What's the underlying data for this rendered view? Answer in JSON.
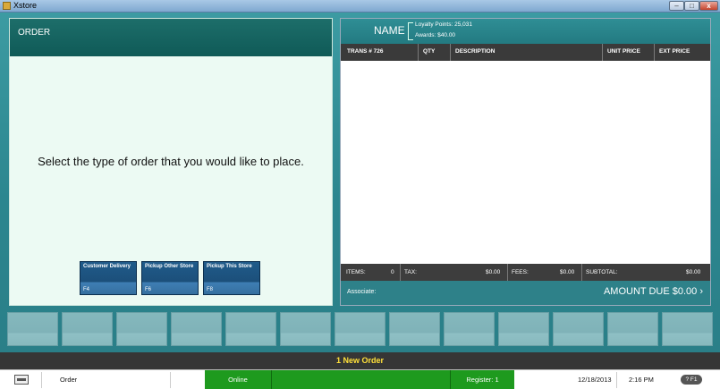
{
  "window": {
    "title": "Xstore",
    "min_symbol": "–",
    "max_symbol": "□",
    "close_symbol": "x"
  },
  "order_panel": {
    "header": "ORDER",
    "prompt": "Select the type of order that you would like to place.",
    "buttons": [
      {
        "label": "Customer Delivery",
        "key": "F4"
      },
      {
        "label": "Pickup Other Store",
        "key": "F6"
      },
      {
        "label": "Pickup This Store",
        "key": "F8"
      }
    ]
  },
  "transaction_panel": {
    "customer_name": "NAME",
    "loyalty_points": "Loyalty Points: 25,031",
    "awards": "Awards: $40.00",
    "columns": [
      "TRANS # 726",
      "QTY",
      "DESCRIPTION",
      "UNIT PRICE",
      "EXT PRICE"
    ],
    "totals": {
      "items_label": "ITEMS:",
      "items_value": "0",
      "tax_label": "TAX:",
      "tax_value": "$0.00",
      "fees_label": "FEES:",
      "fees_value": "$0.00",
      "subtotal_label": "SUBTOTAL:",
      "subtotal_value": "$0.00"
    },
    "associate_label": "Associate:",
    "amount_due": "AMOUNT DUE  $0.00 ›"
  },
  "function_buttons": [
    "",
    "",
    "",
    "",
    "",
    "",
    "",
    "",
    "",
    "",
    "",
    "",
    ""
  ],
  "message": "1 New Order",
  "status_bar": {
    "mode": "Order",
    "connection": "Online",
    "register": "Register: 1",
    "date": "12/18/2013",
    "time": "2:16 PM",
    "help": "? F1"
  },
  "colors": {
    "teal": "#2e8189",
    "green": "#1e9a1e",
    "message": "#ffe03a"
  }
}
